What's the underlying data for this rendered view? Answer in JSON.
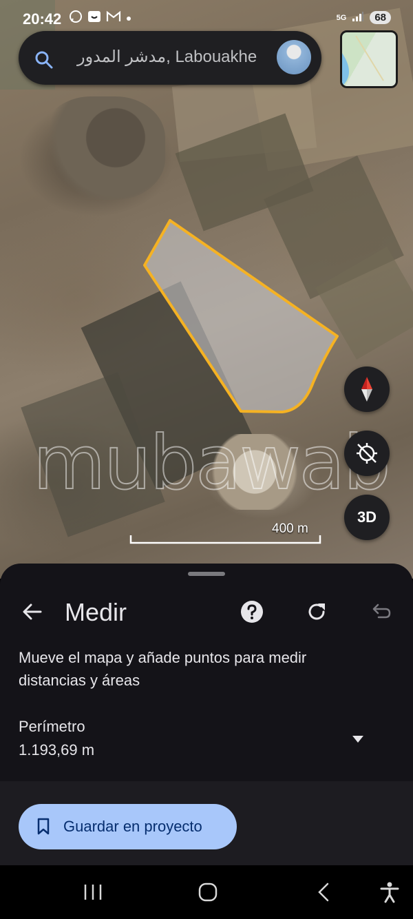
{
  "status_bar": {
    "time": "20:42",
    "signal": "5G",
    "battery": "68"
  },
  "search": {
    "text": "مدشر المدور, Labouakhe"
  },
  "map": {
    "scale_label": "400 m",
    "watermark": "mubawab",
    "buttons": {
      "btn3d_label": "3D"
    }
  },
  "sheet": {
    "title": "Medir",
    "description": "Mueve el mapa y añade puntos para medir distancias y áreas",
    "measure_label": "Perímetro",
    "measure_value": "1.193,69 m",
    "save_label": "Guardar en proyecto"
  },
  "icons": {
    "back": "arrow-left-icon",
    "help": "help-circle-icon",
    "reset": "refresh-icon",
    "undo": "undo-icon",
    "dropdown": "caret-down-icon",
    "bookmark": "bookmark-icon",
    "compass": "compass-icon",
    "location": "location-off-icon"
  },
  "colors": {
    "polygon_stroke": "#f5b223",
    "save_button": "#a8c7fa",
    "sheet_bg": "#141318"
  }
}
